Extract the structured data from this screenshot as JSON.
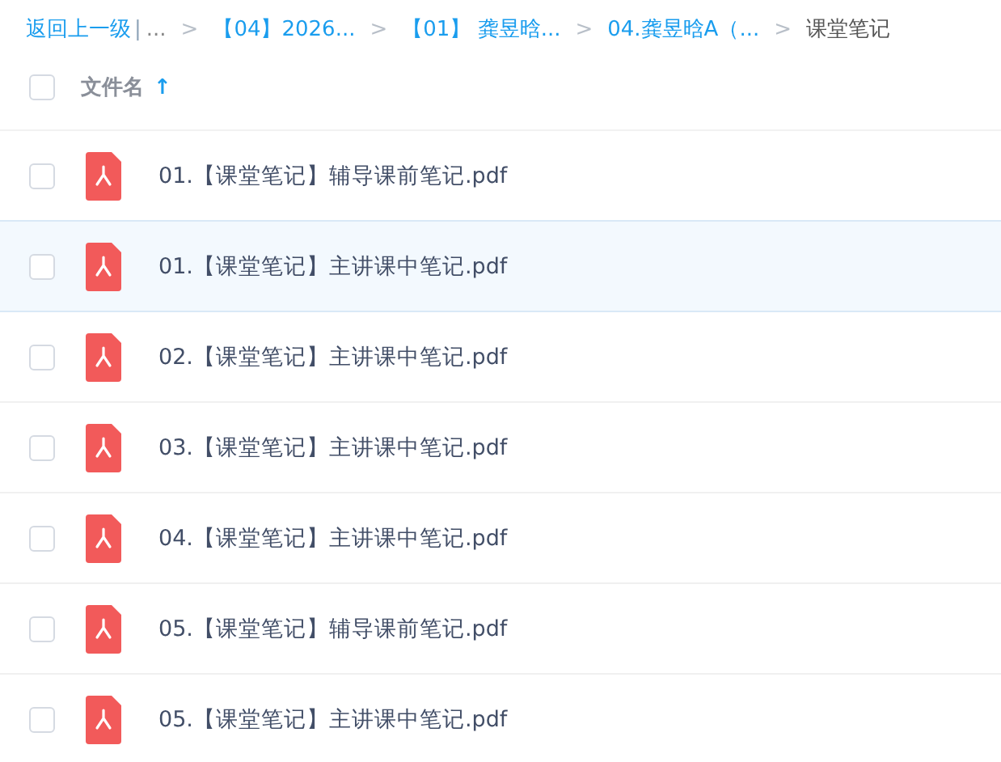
{
  "breadcrumb": {
    "back": "返回上一级",
    "divider": "|",
    "items": [
      {
        "kind": "ellipsis",
        "label": "..."
      },
      {
        "kind": "link",
        "label": "【04】2026...",
        "sep": ">"
      },
      {
        "kind": "link",
        "label": "【01】 龚昱晗...",
        "sep": ">"
      },
      {
        "kind": "link",
        "label": "04.龚昱晗A（...",
        "sep": ">"
      },
      {
        "kind": "current",
        "label": "课堂笔记",
        "sep": ">"
      }
    ]
  },
  "header": {
    "label": "文件名",
    "sort_icon": "↑",
    "checked": false
  },
  "files": [
    {
      "name": "01.【课堂笔记】辅导课前笔记.pdf",
      "highlighted": false,
      "checked": false
    },
    {
      "name": "01.【课堂笔记】主讲课中笔记.pdf",
      "highlighted": true,
      "checked": false
    },
    {
      "name": "02.【课堂笔记】主讲课中笔记.pdf",
      "highlighted": false,
      "checked": false
    },
    {
      "name": "03.【课堂笔记】主讲课中笔记.pdf",
      "highlighted": false,
      "checked": false
    },
    {
      "name": "04.【课堂笔记】主讲课中笔记.pdf",
      "highlighted": false,
      "checked": false
    },
    {
      "name": "05.【课堂笔记】辅导课前笔记.pdf",
      "highlighted": false,
      "checked": false
    },
    {
      "name": "05.【课堂笔记】主讲课中笔记.pdf",
      "highlighted": false,
      "checked": false
    }
  ]
}
